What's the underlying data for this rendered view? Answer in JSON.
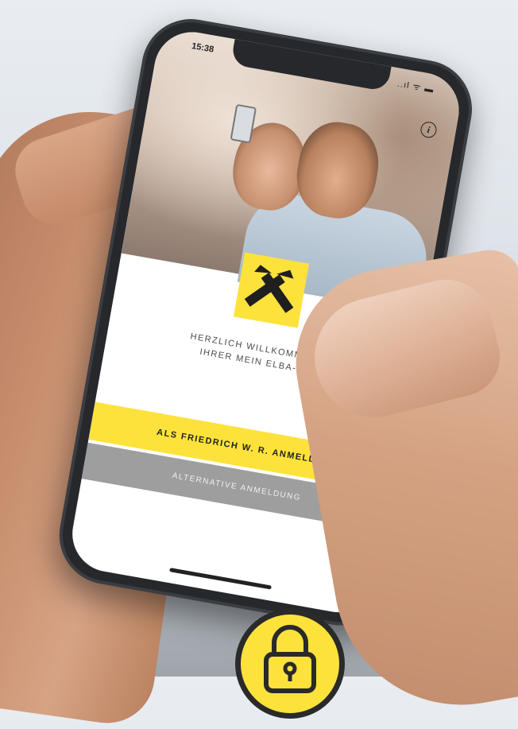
{
  "status_bar": {
    "time": "15:38",
    "icons": "..ıl ᯤ ▬"
  },
  "header": {
    "info_icon": "info-icon"
  },
  "welcome": {
    "line1": "HERZLICH WILLKOMMEN IN",
    "line2": "IHRER MEIN ELBA-APP"
  },
  "buttons": {
    "login_label": "ALS FRIEDRICH W. R. ANMELDEN",
    "alternative_label": "ALTERNATIVE ANMELDUNG"
  },
  "colors": {
    "brand_yellow": "#fde23c",
    "button_gray": "#9e9e9e",
    "phone_body": "#26282c"
  },
  "icons": {
    "logo": "raiffeisen-crossed-gables-logo",
    "badge": "padlock-icon"
  }
}
